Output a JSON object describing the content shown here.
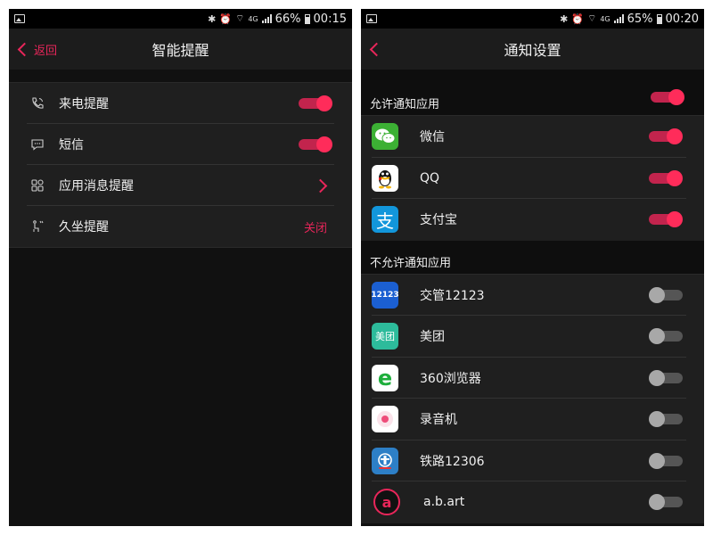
{
  "left_screen": {
    "status": {
      "battery": "66%",
      "time": "00:15",
      "network": "4G"
    },
    "header": {
      "back_label": "返回",
      "title": "智能提醒"
    },
    "items": [
      {
        "label": "来电提醒",
        "icon": "phone-icon",
        "control": "toggle",
        "on": true
      },
      {
        "label": "短信",
        "icon": "message-icon",
        "control": "toggle",
        "on": true
      },
      {
        "label": "应用消息提醒",
        "icon": "apps-grid-icon",
        "control": "chevron"
      },
      {
        "label": "久坐提醒",
        "icon": "sedentary-icon",
        "control": "status",
        "status_text": "关闭"
      }
    ]
  },
  "right_screen": {
    "status": {
      "battery": "65%",
      "time": "00:20",
      "network": "4G"
    },
    "header": {
      "title": "通知设置"
    },
    "allowed_section": {
      "title": "允许通知应用",
      "master_toggle_on": true
    },
    "allowed_apps": [
      {
        "name": "微信",
        "icon": "wechat-icon",
        "on": true
      },
      {
        "name": "QQ",
        "icon": "qq-icon",
        "on": true
      },
      {
        "name": "支付宝",
        "icon": "alipay-icon",
        "on": true
      }
    ],
    "blocked_section": {
      "title": "不允许通知应用"
    },
    "blocked_apps": [
      {
        "name": "交管12123",
        "icon": "traffic-12123-icon",
        "icon_text": "12123",
        "on": false
      },
      {
        "name": "美团",
        "icon": "meituan-icon",
        "icon_text": "美团",
        "on": false
      },
      {
        "name": "360浏览器",
        "icon": "browser-360-icon",
        "icon_text": "e",
        "on": false
      },
      {
        "name": "录音机",
        "icon": "recorder-icon",
        "on": false
      },
      {
        "name": "铁路12306",
        "icon": "railway-12306-icon",
        "on": false
      },
      {
        "name": "a.b.art",
        "icon": "abart-icon",
        "icon_text": "a",
        "on": false
      }
    ]
  },
  "colors": {
    "accent": "#e8265a",
    "background": "#111111",
    "list_bg": "#1f1f1f"
  }
}
